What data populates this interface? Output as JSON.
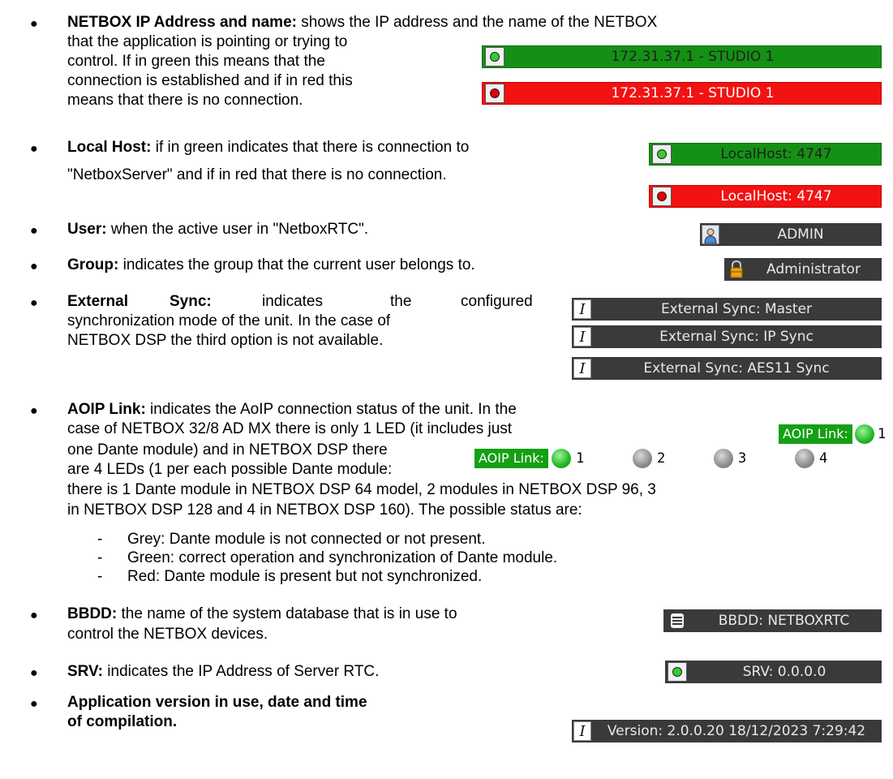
{
  "netbox": {
    "label": "NETBOX IP Address and name:",
    "line1": " shows the IP address and the name of the NETBOX",
    "line2": "that the application is pointing or trying to",
    "line3": "control. If in green this means that the",
    "line4": "connection is established and if in red this",
    "line5": "means that there is no connection.",
    "green_value": "172.31.37.1 - STUDIO 1",
    "red_value": "172.31.37.1 - STUDIO 1"
  },
  "localhost": {
    "label": "Local Host:",
    "line1": " if in green indicates that there is connection to",
    "line2": "\"NetboxServer\" and if in red that there is no connection.",
    "green_value": "LocalHost: 4747",
    "red_value": "LocalHost: 4747"
  },
  "user": {
    "label": "User:",
    "text": " when the active user in \"NetboxRTC\".",
    "value": "ADMIN"
  },
  "group": {
    "label": "Group:",
    "text": " indicates the group that the current user belongs to.",
    "value": "Administrator"
  },
  "extsync": {
    "label": "External",
    "label2": "Sync:",
    "w1": "indicates",
    "w2": "the",
    "w3": "configured",
    "line2": "synchronization mode of the unit. In the case of",
    "line3": "NETBOX DSP the third option is not available.",
    "values": [
      "External Sync: Master",
      "External Sync: IP Sync",
      "External Sync: AES11 Sync"
    ],
    "icon_glyph": "I"
  },
  "aoip": {
    "label": "AOIP Link:",
    "line1": " indicates the AoIP connection status of the unit. In the",
    "line2": "case of NETBOX 32/8 AD MX there is only 1 LED (it includes just",
    "line3": "one Dante module) and in NETBOX DSP there",
    "line4": "are 4 LEDs (1 per each possible Dante module:",
    "line5": "there is 1 Dante module in NETBOX DSP 64 model, 2 modules in NETBOX DSP 96, 3",
    "line6": "in NETBOX DSP 128 and 4 in NETBOX DSP 160). The possible status are:",
    "badge_label": "AOIP Link:",
    "single_led": "1",
    "leds": [
      {
        "num": "1",
        "state": "green"
      },
      {
        "num": "2",
        "state": "grey"
      },
      {
        "num": "3",
        "state": "grey"
      },
      {
        "num": "4",
        "state": "grey"
      }
    ],
    "statuses": [
      "Grey: Dante module is not connected or not present.",
      "Green: correct operation and synchronization of Dante module.",
      "Red: Dante module is present but not synchronized."
    ]
  },
  "bbdd": {
    "label": "BBDD:",
    "line1": " the name of the system database that is in use to",
    "line2": "control the NETBOX devices.",
    "value": "BBDD: NETBOXRTC"
  },
  "srv": {
    "label": "SRV:",
    "text": " indicates the IP Address of Server RTC.",
    "value": "SRV: 0.0.0.0"
  },
  "version": {
    "label1": "Application version in use, date and time",
    "label2": "of compilation.",
    "value": "Version: 2.0.0.20  18/12/2023 7:29:42"
  },
  "colors": {
    "green": "#149114",
    "red": "#f31212",
    "dark_bar": "#3a3a3a",
    "aoip_green": "#14a014"
  }
}
